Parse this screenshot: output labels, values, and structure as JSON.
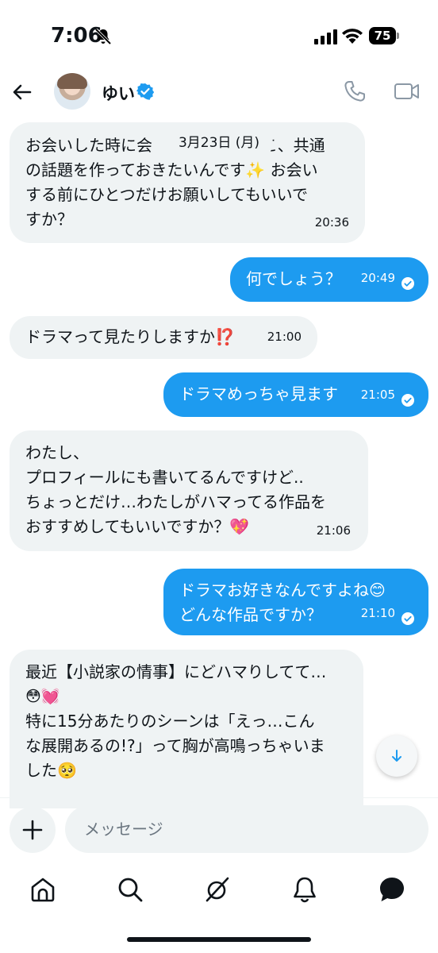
{
  "status_bar": {
    "time": "7:06",
    "battery": "75"
  },
  "header": {
    "name": "ゆい",
    "back_icon": "arrow-left-icon",
    "verified_color": "#1d9bf0"
  },
  "date_separator": "3月23日 (月)",
  "messages": [
    {
      "direction": "in",
      "lines": [
        "お会いした時に会",
        "の話題を作っておきたいんです✨ お会い",
        "する前にひとつだけお願いしてもいいで",
        "すか？"
      ],
      "hidden_fragment": "こ、共通",
      "time": "20:36"
    },
    {
      "direction": "out",
      "lines": [
        "何でしょう？"
      ],
      "time": "20:49",
      "read": true
    },
    {
      "direction": "in",
      "lines": [
        "ドラマって見たりしますか⁉️"
      ],
      "time": "21:00"
    },
    {
      "direction": "out",
      "lines": [
        "ドラマめっちゃ見ます"
      ],
      "time": "21:05",
      "read": true
    },
    {
      "direction": "in",
      "lines": [
        "わたし、",
        "プロフィールにも書いてるんですけど..",
        "ちょっとだけ…わたしがハマってる作品を",
        "おすすめしてもいいですか？💖"
      ],
      "time": "21:06"
    },
    {
      "direction": "out",
      "lines": [
        "ドラマお好きなんですよね😊",
        "どんな作品ですか？"
      ],
      "time": "21:10",
      "read": true
    },
    {
      "direction": "in",
      "lines": [
        "最近【小説家の情事】にどハマりしてて…",
        "😳💓",
        "特に15分あたりのシーンは「えっ…こん",
        "な展開あるの!?」って胸が高鳴っちゃいま",
        "した🥺"
      ]
    }
  ],
  "composer": {
    "placeholder": "メッセージ"
  },
  "tabbar": {
    "items": [
      "home-icon",
      "search-icon",
      "grok-icon",
      "notifications-icon",
      "messages-icon"
    ],
    "active": "messages-icon"
  },
  "colors": {
    "accent": "#1d9bf0",
    "incoming_bubble": "#eff3f4",
    "text": "#0f1419"
  }
}
